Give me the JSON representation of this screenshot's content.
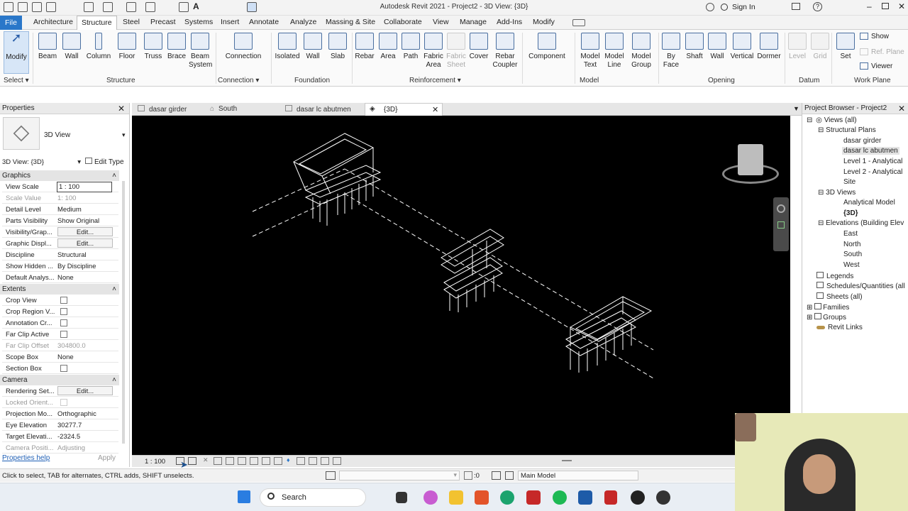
{
  "app": {
    "title": "Autodesk Revit 2021 - Project2 - 3D View: {3D}",
    "signin": "Sign In"
  },
  "ribbon_tabs": [
    "File",
    "Architecture",
    "Structure",
    "Steel",
    "Precast",
    "Systems",
    "Insert",
    "Annotate",
    "Analyze",
    "Massing & Site",
    "Collaborate",
    "View",
    "Manage",
    "Add-Ins",
    "Modify"
  ],
  "ribbon": {
    "modify": "Modify",
    "beam": "Beam",
    "wall": "Wall",
    "column": "Column",
    "floor": "Floor",
    "truss": "Truss",
    "brace": "Brace",
    "beam_system": "Beam System",
    "connection": "Connection",
    "isolated": "Isolated",
    "wall2": "Wall",
    "slab": "Slab",
    "rebar": "Rebar",
    "area": "Area",
    "path": "Path",
    "fabric_area": "Fabric Area",
    "fabric_sheet": "Fabric Sheet",
    "cover": "Cover",
    "rebar_coupler": "Rebar Coupler",
    "component": "Component",
    "model_text": "Model Text",
    "model_line": "Model Line",
    "model_group": "Model Group",
    "by_face": "By Face",
    "shaft": "Shaft",
    "wall3": "Wall",
    "vertical": "Vertical",
    "dormer": "Dormer",
    "level": "Level",
    "grid": "Grid",
    "set": "Set",
    "show": "Show",
    "ref_plane": "Ref. Plane",
    "viewer": "Viewer"
  },
  "panels": {
    "select": "Select",
    "structure": "Structure",
    "connection": "Connection",
    "foundation": "Foundation",
    "reinforcement": "Reinforcement",
    "model": "Model",
    "opening": "Opening",
    "datum": "Datum",
    "work_plane": "Work Plane"
  },
  "properties": {
    "header": "Properties",
    "type_name": "3D View",
    "selector": "3D View: {3D}",
    "edit_type": "Edit Type",
    "help": "Properties help",
    "apply": "Apply",
    "sections": {
      "graphics": "Graphics",
      "extents": "Extents",
      "camera": "Camera"
    },
    "graphics": [
      {
        "k": "View Scale",
        "v": "1 : 100"
      },
      {
        "k": "Scale Value",
        "v": "1: 100"
      },
      {
        "k": "Detail Level",
        "v": "Medium"
      },
      {
        "k": "Parts Visibility",
        "v": "Show Original"
      },
      {
        "k": "Visibility/Grap...",
        "v": "Edit..."
      },
      {
        "k": "Graphic Displ...",
        "v": "Edit..."
      },
      {
        "k": "Discipline",
        "v": "Structural"
      },
      {
        "k": "Show Hidden ...",
        "v": "By Discipline"
      },
      {
        "k": "Default Analys...",
        "v": "None"
      }
    ],
    "extents": [
      {
        "k": "Crop View",
        "v": ""
      },
      {
        "k": "Crop Region V...",
        "v": ""
      },
      {
        "k": "Annotation Cr...",
        "v": ""
      },
      {
        "k": "Far Clip Active",
        "v": ""
      },
      {
        "k": "Far Clip Offset",
        "v": "304800.0"
      },
      {
        "k": "Scope Box",
        "v": "None"
      },
      {
        "k": "Section Box",
        "v": ""
      }
    ],
    "camera": [
      {
        "k": "Rendering Set...",
        "v": "Edit..."
      },
      {
        "k": "Locked Orient...",
        "v": ""
      },
      {
        "k": "Projection Mo...",
        "v": "Orthographic"
      },
      {
        "k": "Eye Elevation",
        "v": "30277.7"
      },
      {
        "k": "Target Elevati...",
        "v": "-2324.5"
      },
      {
        "k": "Camera Positi...",
        "v": "Adjusting"
      }
    ]
  },
  "view_tabs": [
    "dasar girder",
    "South",
    "dasar lc abutmen",
    "{3D}"
  ],
  "viewbar": {
    "scale": "1 : 100"
  },
  "status": {
    "hint": "Click to select, TAB for alternates, CTRL adds, SHIFT unselects.",
    "zero": ":0",
    "model": "Main Model"
  },
  "browser": {
    "header": "Project Browser - Project2",
    "items": [
      "Views (all)",
      "Structural Plans",
      "dasar girder",
      "dasar lc abutmen",
      "Level 1 - Analytical",
      "Level 2 - Analytical",
      "Site",
      "3D Views",
      "Analytical Model",
      "{3D}",
      "Elevations (Building Elev",
      "East",
      "North",
      "South",
      "West",
      "Legends",
      "Schedules/Quantities (all",
      "Sheets (all)",
      "Families",
      "Groups",
      "Revit Links"
    ]
  },
  "taskbar": {
    "search": "Search"
  }
}
